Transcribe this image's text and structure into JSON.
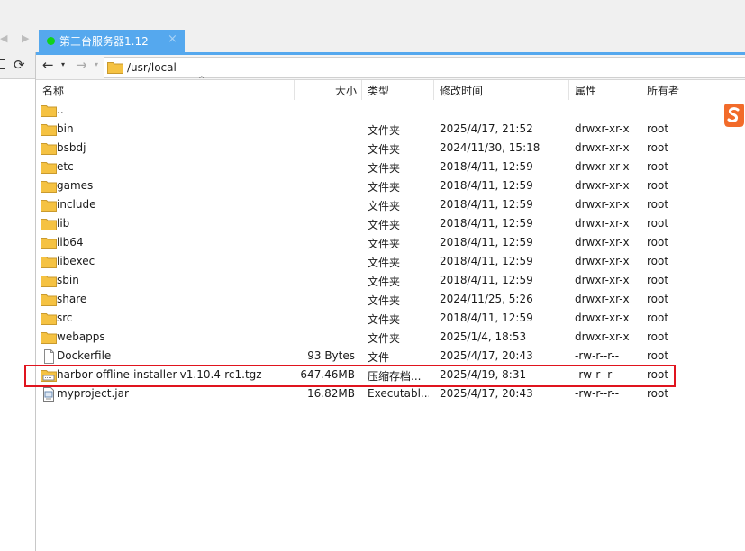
{
  "tab": {
    "title": "第三台服务器1.12",
    "close": "×",
    "status_color": "#11d21a"
  },
  "navigation": {
    "back": "←",
    "forward": "→",
    "dropdown": "▾",
    "path": "/usr/local"
  },
  "columns": {
    "name": "名称",
    "size": "大小",
    "type": "类型",
    "modified": "修改时间",
    "permissions": "属性",
    "owner": "所有者"
  },
  "files": [
    {
      "name": "..",
      "size": "",
      "type": "",
      "modified": "",
      "permissions": "",
      "owner": "",
      "icon": "folder-icon"
    },
    {
      "name": "bin",
      "size": "",
      "type": "文件夹",
      "modified": "2025/4/17, 21:52",
      "permissions": "drwxr-xr-x",
      "owner": "root",
      "icon": "folder-icon"
    },
    {
      "name": "bsbdj",
      "size": "",
      "type": "文件夹",
      "modified": "2024/11/30, 15:18",
      "permissions": "drwxr-xr-x",
      "owner": "root",
      "icon": "folder-icon"
    },
    {
      "name": "etc",
      "size": "",
      "type": "文件夹",
      "modified": "2018/4/11, 12:59",
      "permissions": "drwxr-xr-x",
      "owner": "root",
      "icon": "folder-icon"
    },
    {
      "name": "games",
      "size": "",
      "type": "文件夹",
      "modified": "2018/4/11, 12:59",
      "permissions": "drwxr-xr-x",
      "owner": "root",
      "icon": "folder-icon"
    },
    {
      "name": "include",
      "size": "",
      "type": "文件夹",
      "modified": "2018/4/11, 12:59",
      "permissions": "drwxr-xr-x",
      "owner": "root",
      "icon": "folder-icon"
    },
    {
      "name": "lib",
      "size": "",
      "type": "文件夹",
      "modified": "2018/4/11, 12:59",
      "permissions": "drwxr-xr-x",
      "owner": "root",
      "icon": "folder-icon"
    },
    {
      "name": "lib64",
      "size": "",
      "type": "文件夹",
      "modified": "2018/4/11, 12:59",
      "permissions": "drwxr-xr-x",
      "owner": "root",
      "icon": "folder-icon"
    },
    {
      "name": "libexec",
      "size": "",
      "type": "文件夹",
      "modified": "2018/4/11, 12:59",
      "permissions": "drwxr-xr-x",
      "owner": "root",
      "icon": "folder-icon"
    },
    {
      "name": "sbin",
      "size": "",
      "type": "文件夹",
      "modified": "2018/4/11, 12:59",
      "permissions": "drwxr-xr-x",
      "owner": "root",
      "icon": "folder-icon"
    },
    {
      "name": "share",
      "size": "",
      "type": "文件夹",
      "modified": "2024/11/25, 5:26",
      "permissions": "drwxr-xr-x",
      "owner": "root",
      "icon": "folder-icon"
    },
    {
      "name": "src",
      "size": "",
      "type": "文件夹",
      "modified": "2018/4/11, 12:59",
      "permissions": "drwxr-xr-x",
      "owner": "root",
      "icon": "folder-icon"
    },
    {
      "name": "webapps",
      "size": "",
      "type": "文件夹",
      "modified": "2025/1/4, 18:53",
      "permissions": "drwxr-xr-x",
      "owner": "root",
      "icon": "folder-icon"
    },
    {
      "name": "Dockerfile",
      "size": "93 Bytes",
      "type": "文件",
      "modified": "2025/4/17, 20:43",
      "permissions": "-rw-r--r--",
      "owner": "root",
      "icon": "file-icon"
    },
    {
      "name": "harbor-offline-installer-v1.10.4-rc1.tgz",
      "size": "647.46MB",
      "type": "压缩存档...",
      "modified": "2025/4/19, 8:31",
      "permissions": "-rw-r--r--",
      "owner": "root",
      "icon": "archive-icon"
    },
    {
      "name": "myproject.jar",
      "size": "16.82MB",
      "type": "Executabl...",
      "modified": "2025/4/17, 20:43",
      "permissions": "-rw-r--r--",
      "owner": "root",
      "icon": "jar-file-icon"
    }
  ],
  "colors": {
    "tab_blue": "#55a8ee",
    "highlight": "#e0141e",
    "folder": "#f5c242"
  }
}
